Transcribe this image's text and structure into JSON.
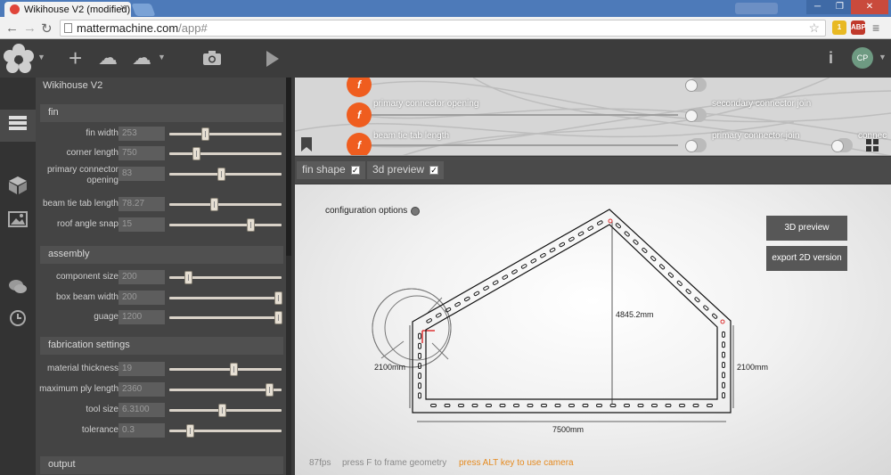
{
  "browser": {
    "tab_title": "Wikihouse V2 (modified)",
    "tab_close": "×",
    "url_host": "mattermachine.com",
    "url_path": "/app#",
    "extensions": [
      {
        "icon": "mail-extension-icon",
        "badge": "1"
      },
      {
        "icon": "adblock-plus-icon",
        "label": "ABP"
      }
    ]
  },
  "toolbar": {
    "avatar_initials": "CP",
    "tools": [
      "logo-flower-icon",
      "add-icon",
      "cloud-download-icon",
      "cloud-upload-icon",
      "camera-icon",
      "play-icon",
      "info-icon"
    ]
  },
  "rail": {
    "items": [
      "parameters-icon",
      "cube-icon",
      "image-icon",
      "chat-icon",
      "history-icon"
    ]
  },
  "panel": {
    "title": "Wikihouse V2",
    "sections": [
      {
        "name": "fin",
        "params": [
          {
            "label": "fin width",
            "value": "253",
            "position": 0.32
          },
          {
            "label": "corner length",
            "value": "750",
            "position": 0.24
          },
          {
            "label": "primary connector opening",
            "value": "83",
            "position": 0.46
          },
          {
            "label": "beam tie tab length",
            "value": "78.27",
            "position": 0.4
          },
          {
            "label": "roof angle snap",
            "value": "15",
            "position": 0.72
          }
        ]
      },
      {
        "name": "assembly",
        "params": [
          {
            "label": "component size",
            "value": "200",
            "position": 0.17
          },
          {
            "label": "box beam width",
            "value": "200",
            "position": 0.97
          },
          {
            "label": "guage",
            "value": "1200",
            "position": 0.97
          }
        ]
      },
      {
        "name": "fabrication settings",
        "params": [
          {
            "label": "material thickness",
            "value": "19",
            "position": 0.57
          },
          {
            "label": "maximum ply length",
            "value": "2360",
            "position": 0.89
          },
          {
            "label": "tool size",
            "value": "6.3100",
            "position": 0.47
          },
          {
            "label": "tolerance",
            "value": "0.3",
            "position": 0.18
          }
        ]
      },
      {
        "name": "output",
        "params": []
      }
    ]
  },
  "graph": {
    "nodes": [
      {
        "label": "primary connector opening",
        "kind": "f"
      },
      {
        "label": "beam tie tab length",
        "kind": "f"
      },
      {
        "label": "secondary connector join",
        "kind": "port"
      },
      {
        "label": "primary connector join",
        "kind": "port"
      },
      {
        "label": "connec",
        "kind": "port"
      }
    ],
    "node_glyph": "f"
  },
  "view_tabs": [
    {
      "label": "fin shape",
      "checked": true
    },
    {
      "label": "3d preview",
      "checked": true
    }
  ],
  "viewport": {
    "config_label": "configuration options",
    "buttons": {
      "preview": "3D preview",
      "export": "export 2D version"
    },
    "dimensions": {
      "width": "7500mm",
      "height": "4845.2mm",
      "left_wall": "2100mm",
      "right_wall": "2100mm"
    },
    "status": {
      "fps": "87fps",
      "frame_hint": "press F to frame geometry",
      "camera_hint": "press ALT key to use camera"
    }
  },
  "colors": {
    "accent_node": "#ef5d1f",
    "hint_text": "#e58a1f",
    "panel_bg": "#444444"
  }
}
